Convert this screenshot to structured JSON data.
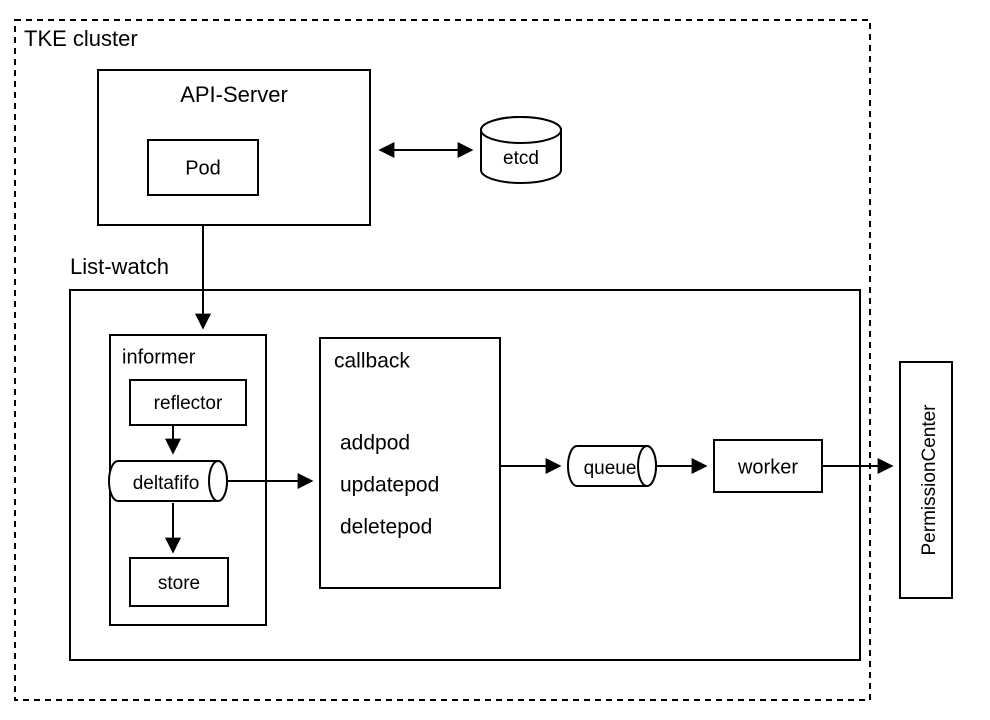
{
  "cluster": {
    "title": "TKE cluster"
  },
  "apiServer": {
    "title": "API-Server",
    "pod": "Pod"
  },
  "etcd": "etcd",
  "listWatch": {
    "title": "List-watch"
  },
  "informer": {
    "title": "informer",
    "reflector": "reflector",
    "deltafifo": "deltafifo",
    "store": "store"
  },
  "callback": {
    "title": "callback",
    "add": "addpod",
    "update": "updatepod",
    "delete": "deletepod"
  },
  "queue": "queue",
  "worker": "worker",
  "permissionCenter": "PermissionCenter"
}
